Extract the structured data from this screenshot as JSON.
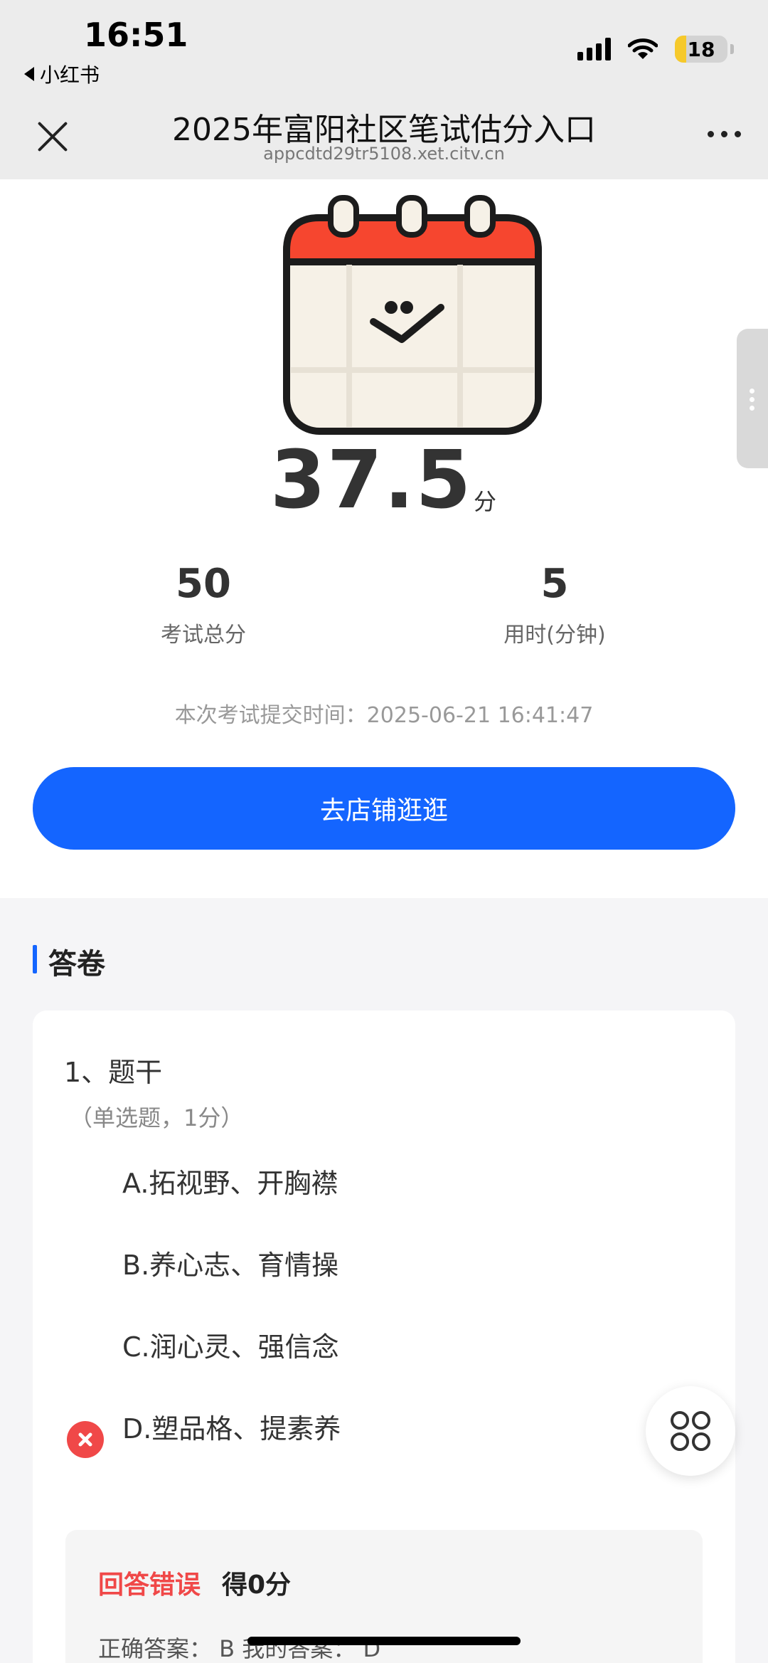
{
  "status_bar": {
    "time": "16:51",
    "back_app": "小红书",
    "battery": "18"
  },
  "navbar": {
    "title": "2025年富阳社区笔试估分入口",
    "url": "appcdtd29tr5108.xet.citv.cn"
  },
  "result": {
    "score": "37.5",
    "score_unit": "分",
    "total_score": "50",
    "total_score_label": "考试总分",
    "time_used": "5",
    "time_used_label": "用时(分钟)",
    "submit_time": "本次考试提交时间：2025-06-21 16:41:47",
    "shop_button": "去店铺逛逛"
  },
  "answer_sheet": {
    "section_title": "答卷",
    "question": {
      "title": "1、题干",
      "type": "（单选题，1分）",
      "options": [
        "A.拓视野、开胸襟",
        "B.养心志、育情操",
        "C.润心灵、强信念",
        "D.塑品格、提素养"
      ],
      "result_label": "回答错误",
      "earned": "得0分",
      "answer_line": "正确答案： B    我的答案： D"
    }
  },
  "colors": {
    "accent": "#1465ff",
    "error": "#f04848",
    "calendar_red": "#f6462f"
  }
}
